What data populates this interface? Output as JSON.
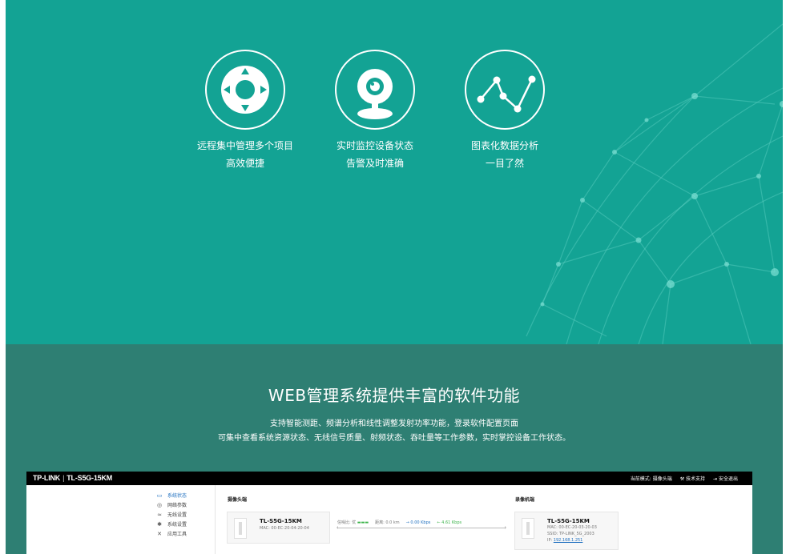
{
  "features": [
    {
      "icon": "remote-control-icon",
      "line1": "远程集中管理多个项目",
      "line2": "高效便捷"
    },
    {
      "icon": "webcam-icon",
      "line1": "实时监控设备状态",
      "line2": "告警及时准确"
    },
    {
      "icon": "line-chart-icon",
      "line1": "图表化数据分析",
      "line2": "一目了然"
    }
  ],
  "headline": "WEB管理系统提供丰富的软件功能",
  "description": {
    "line1": "支持智能测距、频谱分析和线性调整发射功率功能，登录软件配置页面",
    "line2": "可集中查看系统资源状态、无线信号质量、射频状态、吞吐量等工作参数，实时掌控设备工作状态。"
  },
  "app": {
    "brand": "TP-LINK",
    "separator": "|",
    "model": "TL-S5G-15KM",
    "header_links": {
      "mode": "当前模式: 摄像头端",
      "support": "技术支持",
      "logout": "安全退出"
    },
    "nav": [
      {
        "label": "系统状态",
        "icon": "status-icon",
        "glyph": "▭"
      },
      {
        "label": "网络参数",
        "icon": "globe-icon",
        "glyph": "◎"
      },
      {
        "label": "无线设置",
        "icon": "wifi-icon",
        "glyph": "≈"
      },
      {
        "label": "系统设置",
        "icon": "gear-icon",
        "glyph": "✱"
      },
      {
        "label": "应用工具",
        "icon": "tools-icon",
        "glyph": "✕"
      }
    ],
    "camera_side": {
      "title": "摄像头端",
      "device_name": "TL-S5G-15KM",
      "mac": "MAC: 00-EC-20-04-20-04"
    },
    "link": {
      "quality_label": "信噪比: 优",
      "distance": "距离: 0.0 km",
      "tx_rate": "→ 0.00 Kbps",
      "rx_rate": "← 4.61 Kbps"
    },
    "recorder_side": {
      "title": "录像机端",
      "device_name": "TL-S5G-15KM",
      "mac": "MAC: 00-EC-20-03-20-03",
      "ssid": "SSID: TP-LINK_5G_2003",
      "ip_label": "IP:",
      "ip": "192.168.1.251"
    }
  },
  "colors": {
    "top_bg": "#13a394",
    "mid_bg": "#2e7f73",
    "app_header": "#000000",
    "accent": "#1e6fbf"
  }
}
